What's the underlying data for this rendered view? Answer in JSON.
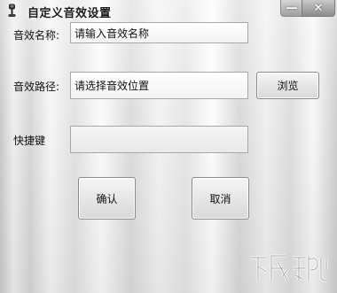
{
  "window": {
    "title": "自定义音效设置",
    "minimize_glyph": "—",
    "close_glyph": "✕"
  },
  "form": {
    "name_label": "音效名称:",
    "name_placeholder": "请输入音效名称",
    "path_label": "音效路径:",
    "path_placeholder": "请选择音效位置",
    "browse_label": "浏览",
    "hotkey_label": "快捷键",
    "hotkey_value": ""
  },
  "actions": {
    "confirm_label": "确认",
    "cancel_label": "取消"
  },
  "icons": {
    "app": "microphone-icon",
    "minimize": "minimize-icon",
    "close": "close-icon"
  }
}
